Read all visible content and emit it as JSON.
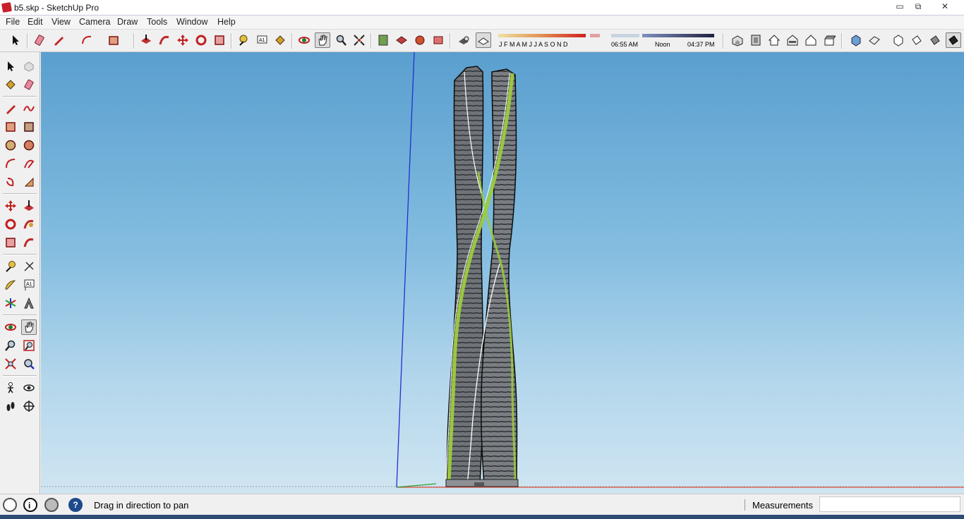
{
  "window": {
    "title": "b5.skp - SketchUp Pro",
    "minimize": "▭",
    "restore": "⧉",
    "close": "✕"
  },
  "menu": [
    "File",
    "Edit",
    "View",
    "Camera",
    "Draw",
    "Tools",
    "Window",
    "Help"
  ],
  "shadow": {
    "months": "J  F  M  A  M  J  J  A  S  O  N  D",
    "time_start": "06:55 AM",
    "time_mid": "Noon",
    "time_end": "04:37 PM"
  },
  "toolbar_icons": [
    "select-icon",
    "eraser-icon",
    "pencil-icon",
    "arc-icon",
    "rectangle-icon",
    "push-pull-icon",
    "follow-me-icon",
    "move-icon",
    "rotate-icon",
    "scale-icon",
    "tape-measure-icon",
    "text-icon",
    "paint-bucket-icon",
    "orbit-icon",
    "pan-icon",
    "zoom-icon",
    "zoom-extents-icon",
    "geo-location-icon",
    "warehouse-icon",
    "components-icon",
    "send-to-layout-icon",
    "xray-icon",
    "back-edges-icon",
    "iso-view-icon",
    "top-view-icon",
    "front-view-icon",
    "right-view-icon",
    "back-view-icon",
    "left-view-icon",
    "wireframe-icon",
    "hidden-line-icon",
    "shaded-icon",
    "shaded-textures-icon",
    "monochrome-icon"
  ],
  "left_tools": [
    "select-icon",
    "component-icon",
    "paint-bucket-icon",
    "eraser-icon",
    "pencil-icon",
    "freehand-icon",
    "rectangle-icon",
    "rotated-rectangle-icon",
    "circle-icon",
    "polygon-icon",
    "arc-icon",
    "two-point-arc-icon",
    "pie-icon",
    "three-point-arc-icon",
    "move-icon",
    "push-pull-icon",
    "rotate-icon",
    "follow-me-icon",
    "scale-icon",
    "offset-icon",
    "tape-measure-icon",
    "dimension-icon",
    "protractor-icon",
    "text-icon",
    "axes-icon",
    "3d-text-icon",
    "orbit-icon",
    "pan-icon",
    "zoom-icon",
    "zoom-window-icon",
    "zoom-extents-icon",
    "previous-view-icon",
    "position-camera-icon",
    "look-around-icon",
    "walk-icon",
    "section-plane-icon"
  ],
  "status": {
    "hint": "Drag in direction to pan",
    "measurements_label": "Measurements",
    "measurements_value": "",
    "help_glyph": "?"
  },
  "colors": {
    "sky_top": "#5a9fcf",
    "sky_bottom": "#d0e5f1",
    "tower_glass": "#6f7378",
    "tower_stripe": "#9ccc3c",
    "axis_blue": "#2030d0",
    "axis_red": "#e05040",
    "axis_green": "#30a030"
  }
}
